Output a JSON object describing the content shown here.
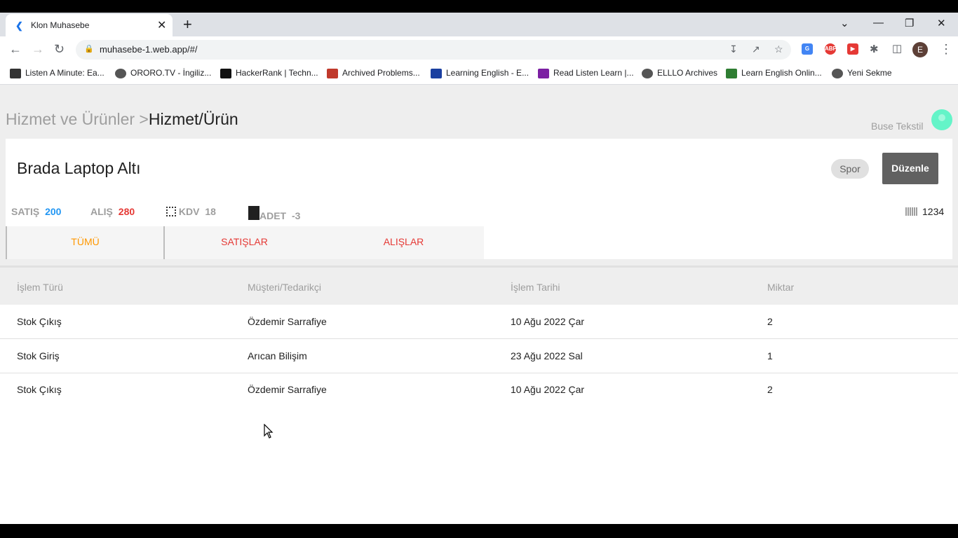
{
  "browser": {
    "tab_title": "Klon Muhasebe",
    "url": "muhasebe-1.web.app/#/",
    "profile_initial": "E",
    "bookmarks": [
      {
        "label": "Listen A Minute: Ea...",
        "color": "#333333"
      },
      {
        "label": "ORORO.TV - İngiliz...",
        "color": "#555555"
      },
      {
        "label": "HackerRank | Techn...",
        "color": "#111111"
      },
      {
        "label": "Archived Problems...",
        "color": "#c0392b"
      },
      {
        "label": "Learning English - E...",
        "color": "#1a3fa0"
      },
      {
        "label": "Read Listen Learn |...",
        "color": "#7b1fa2"
      },
      {
        "label": "ELLLO Archives",
        "color": "#555555"
      },
      {
        "label": "Learn English Onlin...",
        "color": "#2e7d32"
      },
      {
        "label": "Yeni Sekme",
        "color": "#555555"
      }
    ]
  },
  "breadcrumb": {
    "parent": "Hizmet ve Ürünler >",
    "current": "Hizmet/Ürün"
  },
  "company": "Buse Tekstil",
  "product": {
    "name": "Brada Laptop Altı",
    "category_chip": "Spor",
    "edit_label": "Düzenle",
    "stats": {
      "sale_label": "SATIŞ",
      "sale_value": "200",
      "buy_label": "ALIŞ",
      "buy_value": "280",
      "kdv_label": "KDV",
      "kdv_value": "18",
      "qty_label": "ADET",
      "qty_value": "-3",
      "barcode_value": "1234"
    }
  },
  "tabs": [
    {
      "label": "TÜMÜ",
      "active": true
    },
    {
      "label": "SATIŞLAR",
      "active": false
    },
    {
      "label": "ALIŞLAR",
      "active": false
    }
  ],
  "table": {
    "headers": [
      "İşlem Türü",
      "Müşteri/Tedarikçi",
      "İşlem Tarihi",
      "Miktar"
    ],
    "rows": [
      [
        "Stok Çıkış",
        "Özdemir Sarrafiye",
        "10 Ağu 2022 Çar",
        "2"
      ],
      [
        "Stok Giriş",
        "Arıcan Bilişim",
        "23 Ağu 2022 Sal",
        "1"
      ],
      [
        "Stok Çıkış",
        "Özdemir Sarrafiye",
        "10 Ağu 2022 Çar",
        "2"
      ]
    ]
  },
  "colors": {
    "sale": "#2196f3",
    "buy": "#e53935",
    "active_tab": "#ff9800",
    "inactive_tab": "#e53935"
  }
}
